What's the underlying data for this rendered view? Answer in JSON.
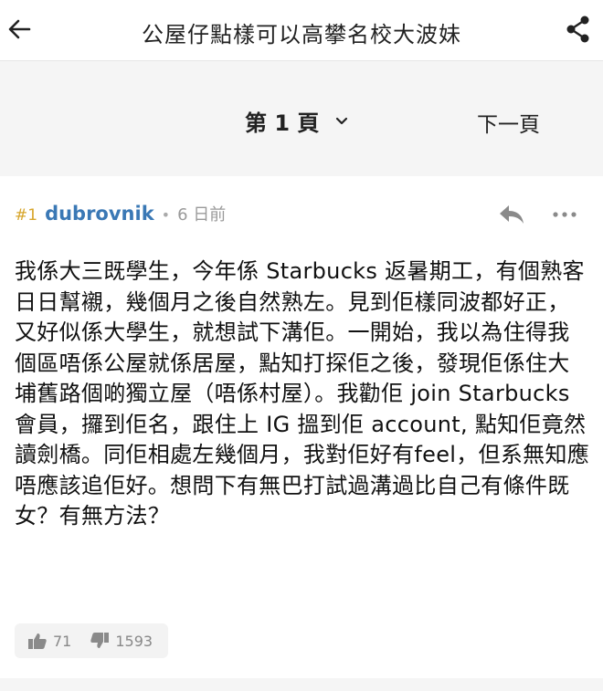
{
  "header": {
    "title": "公屋仔點樣可以高攀名校大波妹"
  },
  "pagination": {
    "current_page_label": "第 1 頁",
    "next_page_label": "下一頁"
  },
  "post": {
    "floor": "#1",
    "username": "dubrovnik",
    "separator": "•",
    "time_ago": "6 日前",
    "content": "我係大三既學生，今年係 Starbucks 返暑期工，有個熟客日日幫襯，幾個月之後自然熟左。見到佢樣同波都好正，又好似係大學生，就想試下溝佢。一開始，我以為住得我個區唔係公屋就係居屋，點知打探佢之後，發現佢係住大埔舊路個啲獨立屋（唔係村屋）。我勸佢 join Starbucks 會員，攞到佢名，跟住上 IG 搵到佢 account, 點知佢竟然讀劍橋。同佢相處左幾個月，我對佢好有feel，但系無知應唔應該追佢好。想問下有無巴打試過溝過比自己有條件既女？有無方法？",
    "likes": "71",
    "dislikes": "1593"
  },
  "icons": {
    "back": "arrow-left-icon",
    "share": "share-icon",
    "reply": "reply-icon",
    "more": "more-icon",
    "like": "thumbs-up-icon",
    "dislike": "thumbs-down-icon",
    "dropdown": "chevron-down-icon"
  },
  "colors": {
    "username": "#3a78b5",
    "floor": "#d7a52a",
    "meta_gray": "#9a9a9a",
    "page_bg": "#f5f5f5"
  }
}
